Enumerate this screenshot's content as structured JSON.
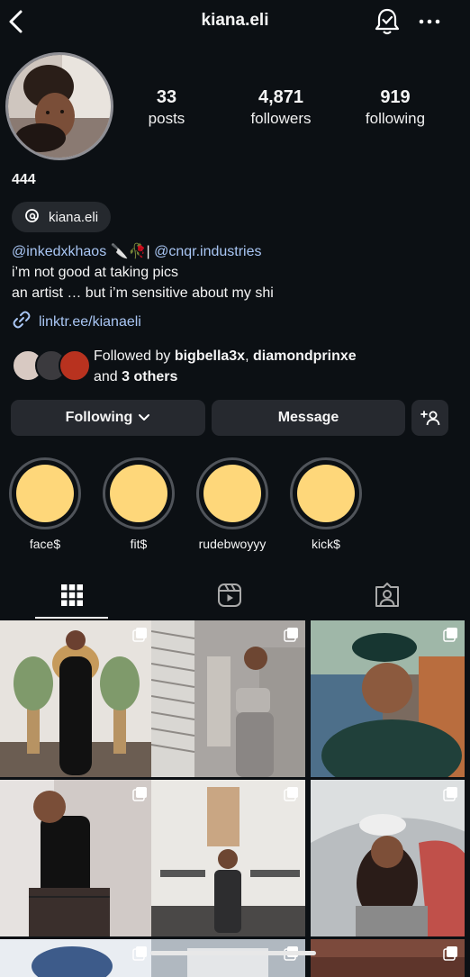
{
  "header": {
    "username": "kiana.eli",
    "icons": {
      "back": "chevron-left-icon",
      "notifications": "bell-check-icon",
      "more": "more-horizontal-icon"
    }
  },
  "stats": [
    {
      "value": "33",
      "label": "posts"
    },
    {
      "value": "4,871",
      "label": "followers"
    },
    {
      "value": "919",
      "label": "following"
    }
  ],
  "profile": {
    "display_name": "444",
    "threads_handle": "kiana.eli",
    "bio_line1_mention1": "@inkedxkhaos",
    "bio_line1_middle": " 🔪🥀| ",
    "bio_line1_mention2": "@cnqr.industries",
    "bio_line2": "i’m not good at taking pics",
    "bio_line3": "an artist … but i’m sensitive about my shi",
    "link": "linktr.ee/kianaeli"
  },
  "followed_by": {
    "prefix": "Followed by ",
    "user1": "bigbella3x",
    "sep": ", ",
    "user2": "diamondprinxe",
    "line2_prefix": "and ",
    "others": "3 others"
  },
  "actions": {
    "following": "Following",
    "message": "Message"
  },
  "highlights": [
    {
      "label": "face$"
    },
    {
      "label": "fit$"
    },
    {
      "label": "rudebwoyyy"
    },
    {
      "label": "kick$"
    }
  ],
  "colors": {
    "background": "#0c1014",
    "highlight_fill": "#fed77a",
    "mention": "#a9c6f4",
    "button": "#26292f"
  }
}
